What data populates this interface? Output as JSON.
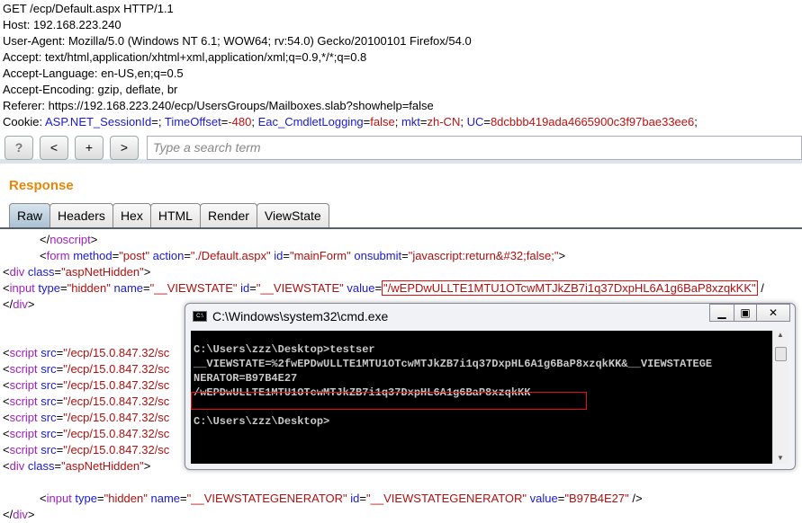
{
  "request": {
    "lines": [
      "GET /ecp/Default.aspx HTTP/1.1",
      "Host: 192.168.223.240",
      "User-Agent: Mozilla/5.0 (Windows NT 6.1; WOW64; rv:54.0) Gecko/20100101 Firefox/54.0",
      "Accept: text/html,application/xhtml+xml,application/xml;q=0.9,*/*;q=0.8",
      "Accept-Language: en-US,en;q=0.5",
      "Accept-Encoding: gzip, deflate, br",
      "Referer: https://192.168.223.240/ecp/UsersGroups/Mailboxes.slab?showhelp=false"
    ],
    "cookie_label": "Cookie: ",
    "cookies": [
      {
        "k": "ASP.NET_SessionId",
        "v": ""
      },
      {
        "k": "TimeOffset",
        "v": "-480"
      },
      {
        "k": "Eac_CmdletLogging",
        "v": "false"
      },
      {
        "k": "mkt",
        "v": "zh-CN"
      },
      {
        "k": "UC",
        "v": "8dcbbb419ada4665900c3f97bae33ee6"
      }
    ]
  },
  "toolbar": {
    "help": "?",
    "prev": "<",
    "add": "+",
    "next": ">",
    "search_placeholder": "Type a search term"
  },
  "response": {
    "title": "Response",
    "tabs": [
      "Raw",
      "Headers",
      "Hex",
      "HTML",
      "Render",
      "ViewState"
    ],
    "active_tab": "Raw"
  },
  "code": {
    "noscript": "noscript",
    "form": "form",
    "method": "method",
    "post": "\"post\"",
    "action": "action",
    "action_v": "\"./Default.aspx\"",
    "id": "id",
    "mainForm": "\"mainForm\"",
    "onsubmit": "onsubmit",
    "onsubmit_v": "\"javascript:return&#32;false;\"",
    "div": "div",
    "class": "class",
    "aspNetHidden": "\"aspNetHidden\"",
    "input": "input",
    "type": "type",
    "hidden": "\"hidden\"",
    "name": "name",
    "vs": "\"__VIEWSTATE\"",
    "value": "value",
    "vs_value": "\"/wEPDwULLTE1MTU1OTcwMTJkZB7i1q37DxpHL6A1g6BaP8xzqkKK\"",
    "script": "script",
    "src": "src",
    "src_v": "\"/ecp/15.0.847.32/sc",
    "vsg": "\"__VIEWSTATEGENERATOR\"",
    "vsg_value": "\"B97B4E27\""
  },
  "cmd": {
    "title": "C:\\Windows\\system32\\cmd.exe",
    "lines": [
      "C:\\Users\\zzz\\Desktop>testser",
      "__VIEWSTATE=%2fwEPDwULLTE1MTU1OTcwMTJkZB7i1q37DxpHL6A1g6BaP8xzqkKK&__VIEWSTATEGE",
      "NERATOR=B97B4E27",
      "/wEPDwULLTE1MTU1OTcwMTJkZB7i1q37DxpHL6A1g6BaP8xzqkKK",
      "",
      "C:\\Users\\zzz\\Desktop>"
    ]
  }
}
